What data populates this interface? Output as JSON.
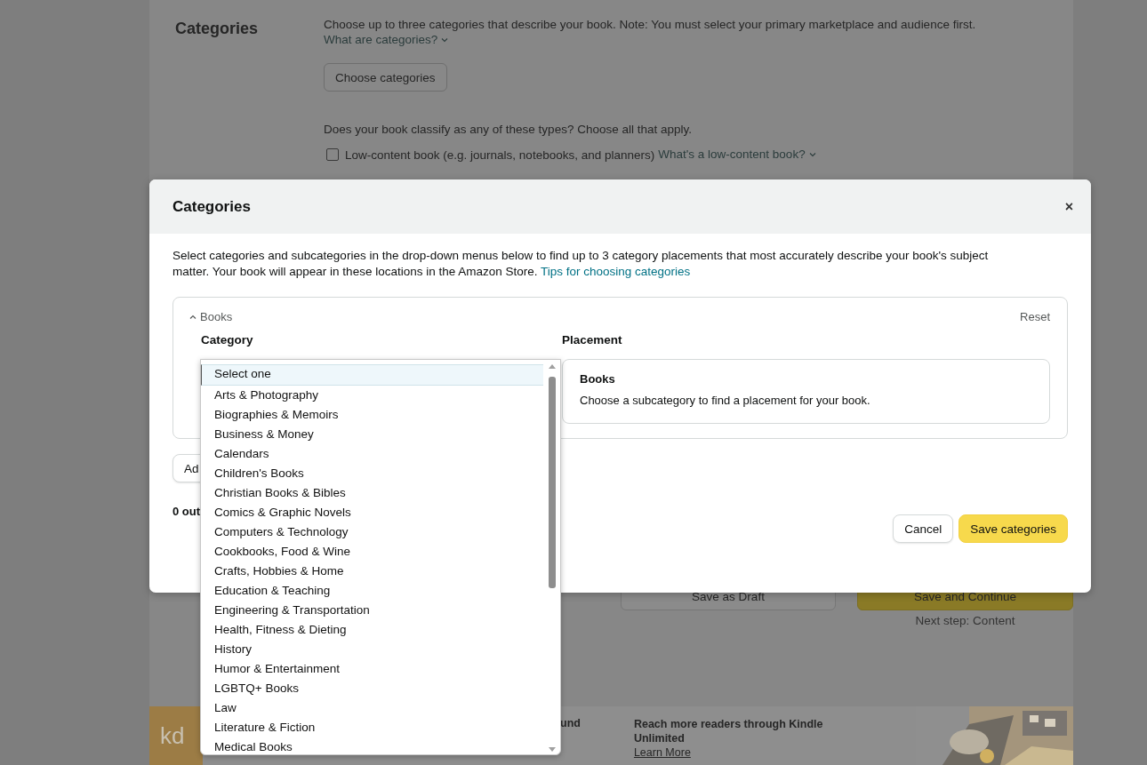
{
  "page": {
    "section_title": "Categories",
    "description": "Choose up to three categories that describe your book. Note: You must select your primary marketplace and audience first.",
    "help_link": "What are categories?",
    "choose_button": "Choose categories",
    "types_question": "Does your book classify as any of these types? Choose all that apply.",
    "types": [
      {
        "label": "Low-content book (e.g. journals, notebooks, and planners)",
        "checked": false,
        "help_link": "What's a low-content book?"
      }
    ],
    "actions": [
      {
        "label": "Save as Draft",
        "kind": "secondary"
      },
      {
        "label": "Save and Continue",
        "kind": "primary"
      }
    ],
    "next_step": "Next step: Content"
  },
  "footer": {
    "logo": "kd",
    "promo_fragment": "und",
    "promo_title": "Reach more readers through Kindle Unlimited",
    "promo_link": "Learn More"
  },
  "modal": {
    "title": "Categories",
    "close": "×",
    "intro": "Select categories and subcategories in the drop-down menus below to find up to 3 category placements that most accurately describe your book's subject matter. Your book will appear in these locations in the Amazon Store.",
    "intro_link": "Tips for choosing categories",
    "group": {
      "label": "Books",
      "expanded": true,
      "reset": "Reset",
      "category_label": "Category",
      "placement_label": "Placement",
      "placement": {
        "title": "Books",
        "hint": "Choose a subcategory to find a placement for your book."
      }
    },
    "add_button": "Ad",
    "count_text": "0 out",
    "buttons": [
      {
        "label": "Cancel",
        "kind": "secondary"
      },
      {
        "label": "Save categories",
        "kind": "primary"
      }
    ]
  },
  "dropdown": {
    "options": [
      {
        "label": "Select one",
        "selected": true
      },
      {
        "label": "Arts & Photography",
        "selected": false
      },
      {
        "label": "Biographies & Memoirs",
        "selected": false
      },
      {
        "label": "Business & Money",
        "selected": false
      },
      {
        "label": "Calendars",
        "selected": false
      },
      {
        "label": "Children's Books",
        "selected": false
      },
      {
        "label": "Christian Books & Bibles",
        "selected": false
      },
      {
        "label": "Comics & Graphic Novels",
        "selected": false
      },
      {
        "label": "Computers & Technology",
        "selected": false
      },
      {
        "label": "Cookbooks, Food & Wine",
        "selected": false
      },
      {
        "label": "Crafts, Hobbies & Home",
        "selected": false
      },
      {
        "label": "Education & Teaching",
        "selected": false
      },
      {
        "label": "Engineering & Transportation",
        "selected": false
      },
      {
        "label": "Health, Fitness & Dieting",
        "selected": false
      },
      {
        "label": "History",
        "selected": false
      },
      {
        "label": "Humor & Entertainment",
        "selected": false
      },
      {
        "label": "LGBTQ+ Books",
        "selected": false
      },
      {
        "label": "Law",
        "selected": false
      },
      {
        "label": "Literature & Fiction",
        "selected": false
      },
      {
        "label": "Medical Books",
        "selected": false
      }
    ]
  }
}
